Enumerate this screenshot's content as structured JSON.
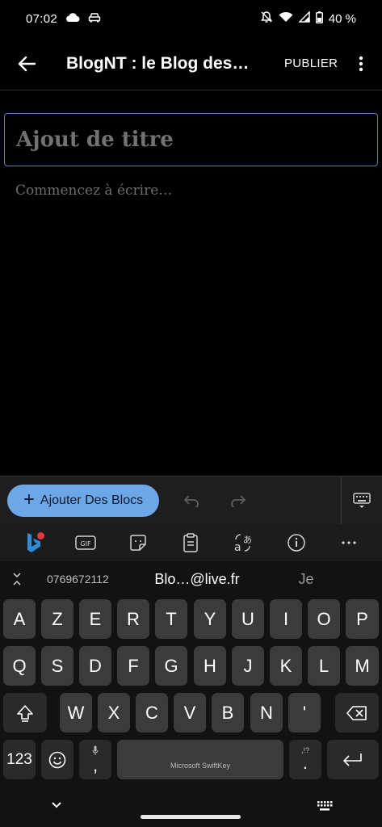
{
  "status": {
    "time": "07:02",
    "battery": "40 %"
  },
  "app_bar": {
    "title": "BlogNT : le Blog des…",
    "publish": "PUBLIER"
  },
  "editor": {
    "title_placeholder": "Ajout de titre",
    "body_placeholder": "Commencez à écrire…"
  },
  "toolbar": {
    "add_blocks": "Ajouter Des Blocs"
  },
  "keyboard": {
    "suggestions": [
      "0769672112",
      "Blo…@live.fr",
      "Je"
    ],
    "row1": [
      "A",
      "Z",
      "E",
      "R",
      "T",
      "Y",
      "U",
      "I",
      "O",
      "P"
    ],
    "row2": [
      "Q",
      "S",
      "D",
      "F",
      "G",
      "H",
      "J",
      "K",
      "L",
      "M"
    ],
    "row3": [
      "W",
      "X",
      "C",
      "V",
      "B",
      "N",
      "'"
    ],
    "numbers": "123",
    "comma": ",",
    "period": ".",
    "punct_hint": ",!?",
    "space_label": "Microsoft SwiftKey",
    "tools": [
      "bing-icon",
      "gif-icon",
      "sticker-icon",
      "clipboard-icon",
      "translate-icon",
      "info-icon",
      "more-icon"
    ],
    "gif_label": "GIF"
  },
  "colors": {
    "accent": "#6ea7e8",
    "title_border": "#5b7fb4",
    "key": "#3b3b3b",
    "key_dark": "#2a2a2a"
  }
}
